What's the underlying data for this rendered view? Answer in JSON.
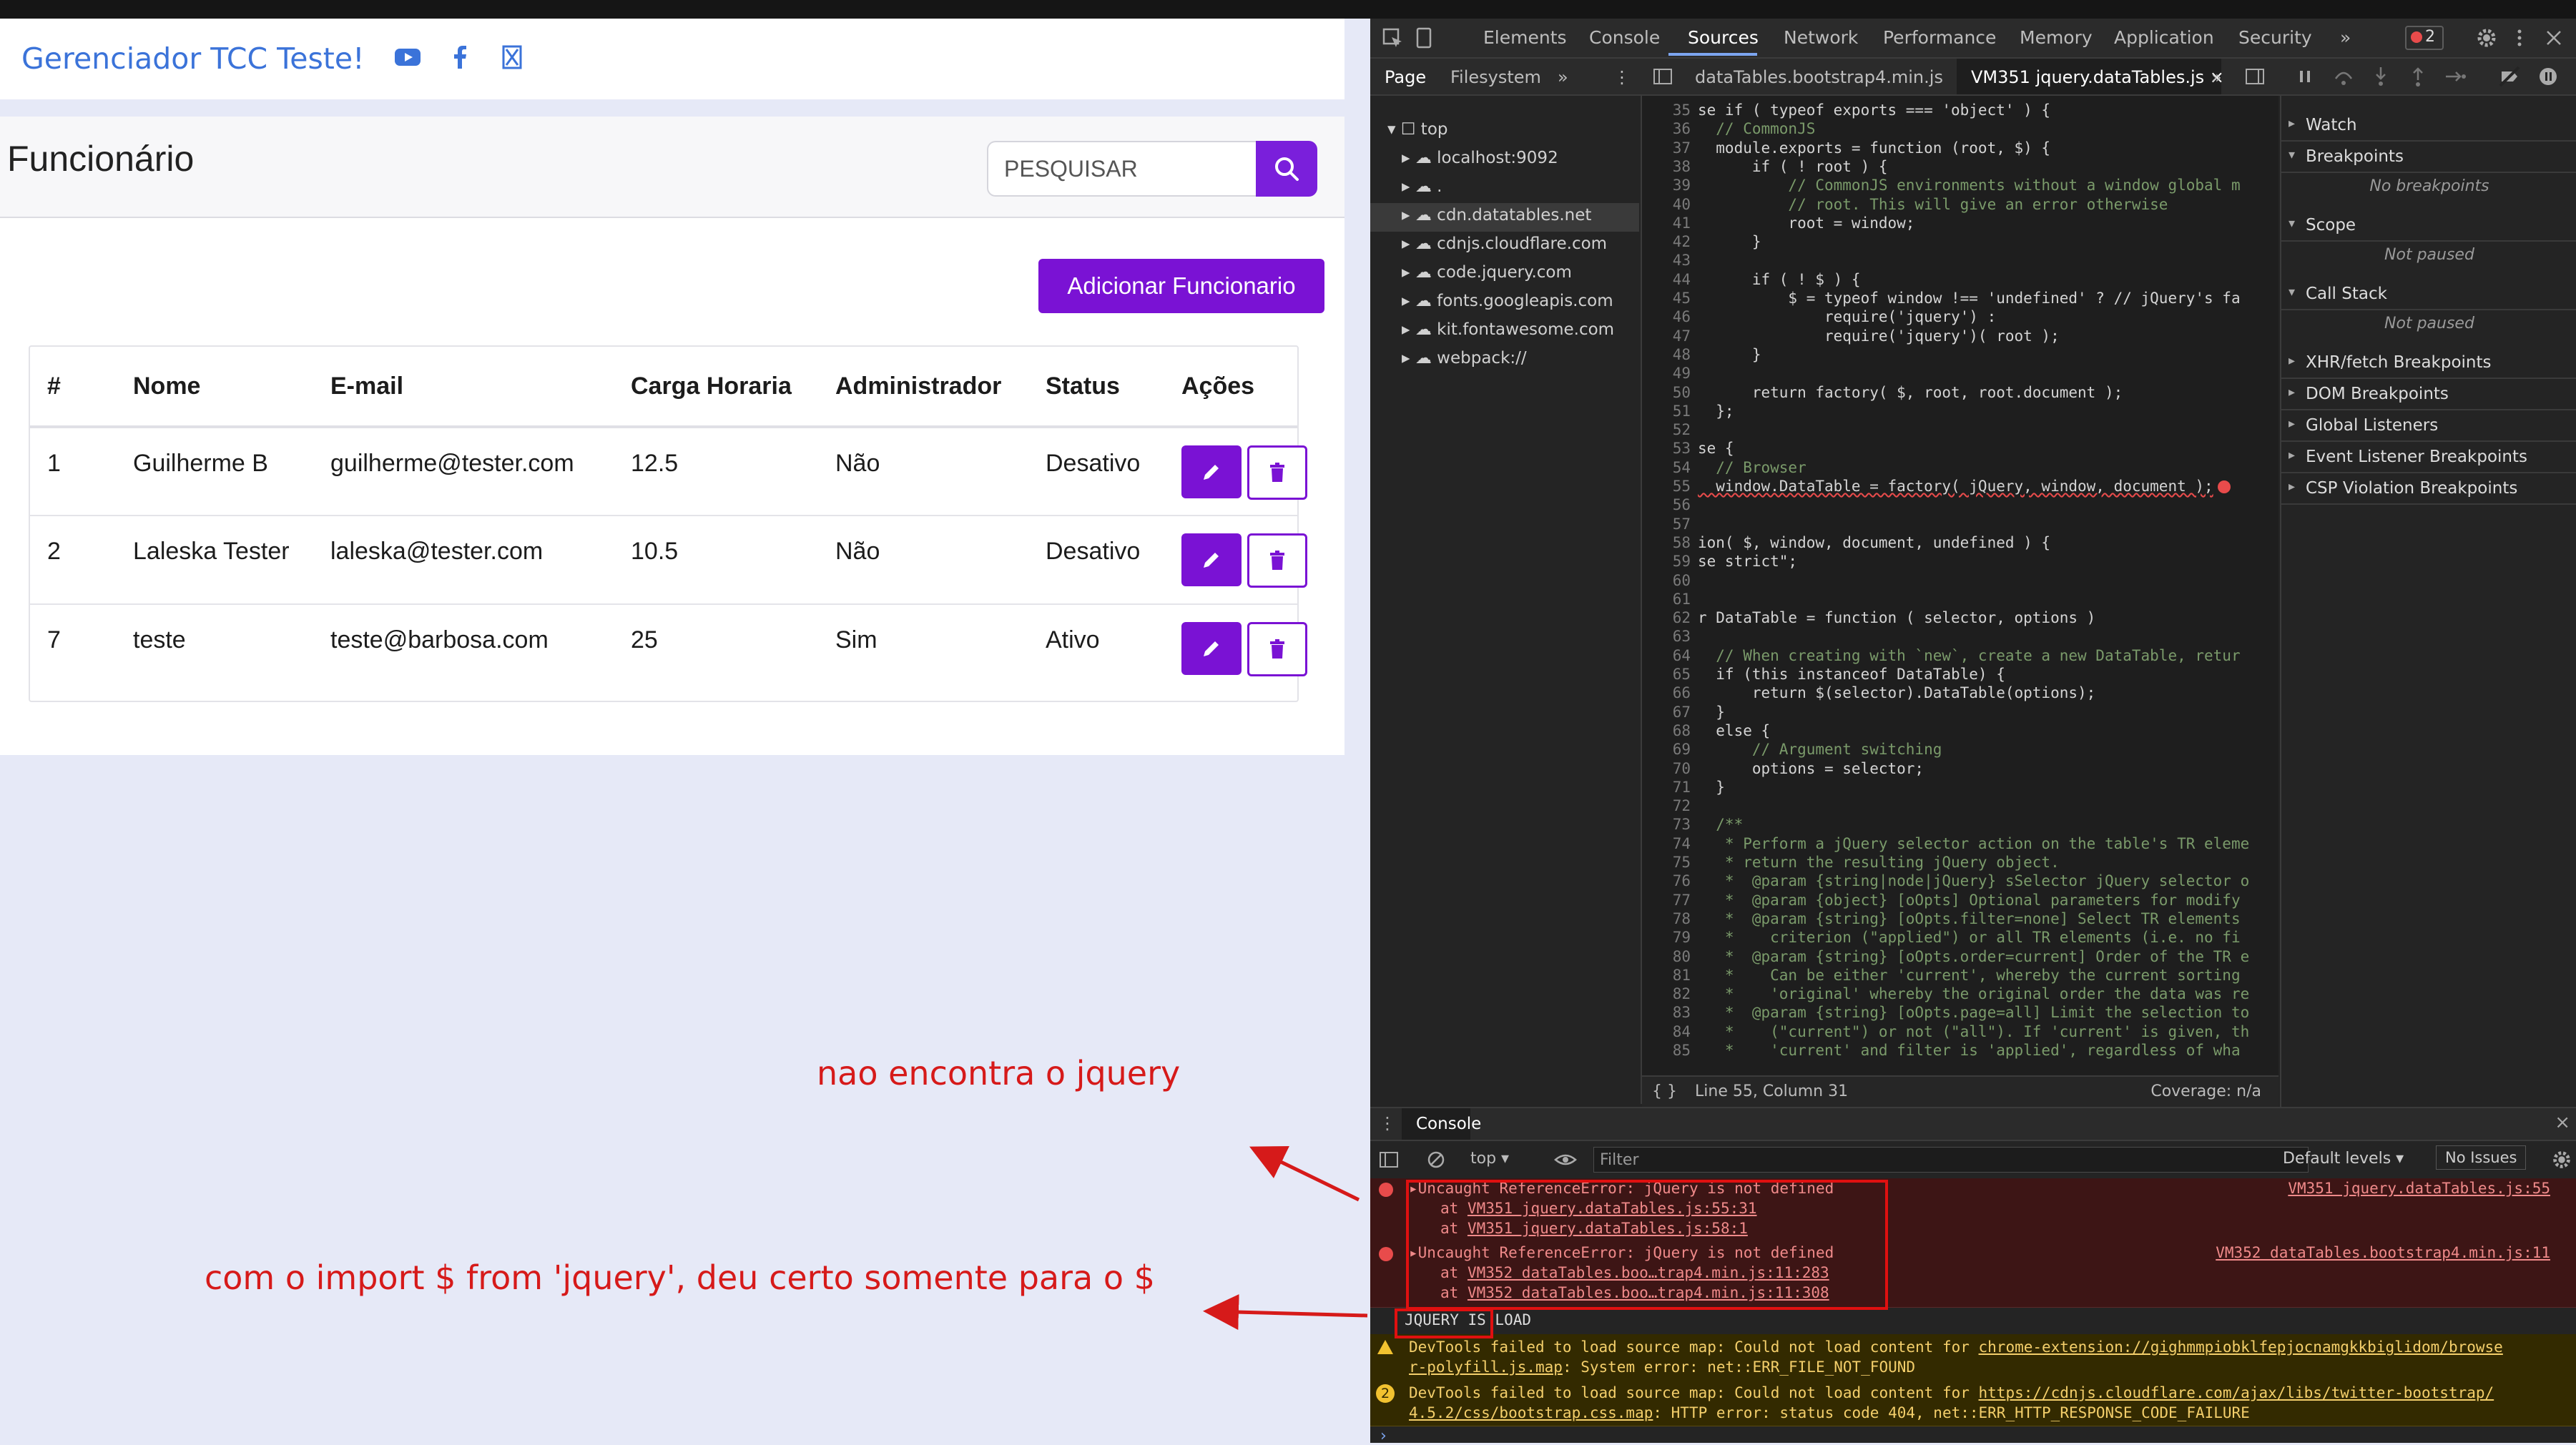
{
  "app": {
    "brand": "Gerenciador TCC Teste!",
    "social_icons": [
      "youtube-icon",
      "facebook-icon",
      "x-twitter-icon"
    ],
    "page_title": "Funcionário",
    "search": {
      "placeholder": "PESQUISAR"
    },
    "add_button": "Adicionar Funcionario",
    "table": {
      "headers": [
        "#",
        "Nome",
        "E-mail",
        "Carga Horaria",
        "Administrador",
        "Status",
        "Ações"
      ],
      "rows": [
        {
          "id": "1",
          "nome": "Guilherme B",
          "email": "guilherme@tester.com",
          "carga": "12.5",
          "admin": "Não",
          "status": "Desativo"
        },
        {
          "id": "2",
          "nome": "Laleska Tester",
          "email": "laleska@tester.com",
          "carga": "10.5",
          "admin": "Não",
          "status": "Desativo"
        },
        {
          "id": "7",
          "nome": "teste",
          "email": "teste@barbosa.com",
          "carga": "25",
          "admin": "Sim",
          "status": "Ativo"
        }
      ]
    },
    "accent_color": "#7a12d4",
    "brand_color": "#3b73d9"
  },
  "annotations": {
    "note1": "nao encontra o jquery",
    "note2": "com o import $ from 'jquery', deu certo somente para o $",
    "color": "#d61a1a"
  },
  "devtools": {
    "tabs": [
      "Elements",
      "Console",
      "Sources",
      "Network",
      "Performance",
      "Memory",
      "Application",
      "Security"
    ],
    "active_tab": "Sources",
    "error_count": "2",
    "sub_tabs": {
      "page": "Page",
      "filesystem": "Filesystem"
    },
    "file_tabs": [
      "dataTables.bootstrap4.min.js",
      "VM351 jquery.dataTables.js"
    ],
    "tree": [
      "top",
      "localhost:9092",
      ".",
      "cdn.datatables.net",
      "cdnjs.cloudflare.com",
      "code.jquery.com",
      "fonts.googleapis.com",
      "kit.fontawesome.com",
      "webpack://"
    ],
    "code_lines": [
      {
        "n": "35",
        "t": "se if ( typeof exports === 'object' ) {"
      },
      {
        "n": "36",
        "t": "  // CommonJS"
      },
      {
        "n": "37",
        "t": "  module.exports = function (root, $) {"
      },
      {
        "n": "38",
        "t": "      if ( ! root ) {"
      },
      {
        "n": "39",
        "t": "          // CommonJS environments without a window global m"
      },
      {
        "n": "40",
        "t": "          // root. This will give an error otherwise"
      },
      {
        "n": "41",
        "t": "          root = window;"
      },
      {
        "n": "42",
        "t": "      }"
      },
      {
        "n": "43",
        "t": ""
      },
      {
        "n": "44",
        "t": "      if ( ! $ ) {"
      },
      {
        "n": "45",
        "t": "          $ = typeof window !== 'undefined' ? // jQuery's fa"
      },
      {
        "n": "46",
        "t": "              require('jquery') :"
      },
      {
        "n": "47",
        "t": "              require('jquery')( root );"
      },
      {
        "n": "48",
        "t": "      }"
      },
      {
        "n": "49",
        "t": ""
      },
      {
        "n": "50",
        "t": "      return factory( $, root, root.document );"
      },
      {
        "n": "51",
        "t": "  };"
      },
      {
        "n": "52",
        "t": ""
      },
      {
        "n": "53",
        "t": "se {"
      },
      {
        "n": "54",
        "t": "  // Browser"
      },
      {
        "n": "55",
        "t": "  window.DataTable = factory( jQuery, window, document );"
      },
      {
        "n": "56",
        "t": ""
      },
      {
        "n": "57",
        "t": ""
      },
      {
        "n": "58",
        "t": "ion( $, window, document, undefined ) {"
      },
      {
        "n": "59",
        "t": "se strict\";"
      },
      {
        "n": "60",
        "t": ""
      },
      {
        "n": "61",
        "t": ""
      },
      {
        "n": "62",
        "t": "r DataTable = function ( selector, options )"
      },
      {
        "n": "63",
        "t": ""
      },
      {
        "n": "64",
        "t": "  // When creating with `new`, create a new DataTable, retur"
      },
      {
        "n": "65",
        "t": "  if (this instanceof DataTable) {"
      },
      {
        "n": "66",
        "t": "      return $(selector).DataTable(options);"
      },
      {
        "n": "67",
        "t": "  }"
      },
      {
        "n": "68",
        "t": "  else {"
      },
      {
        "n": "69",
        "t": "      // Argument switching"
      },
      {
        "n": "70",
        "t": "      options = selector;"
      },
      {
        "n": "71",
        "t": "  }"
      },
      {
        "n": "72",
        "t": ""
      },
      {
        "n": "73",
        "t": "  /**"
      },
      {
        "n": "74",
        "t": "   * Perform a jQuery selector action on the table's TR eleme"
      },
      {
        "n": "75",
        "t": "   * return the resulting jQuery object."
      },
      {
        "n": "76",
        "t": "   *  @param {string|node|jQuery} sSelector jQuery selector o"
      },
      {
        "n": "77",
        "t": "   *  @param {object} [oOpts] Optional parameters for modify"
      },
      {
        "n": "78",
        "t": "   *  @param {string} [oOpts.filter=none] Select TR elements"
      },
      {
        "n": "79",
        "t": "   *    criterion (\"applied\") or all TR elements (i.e. no fi"
      },
      {
        "n": "80",
        "t": "   *  @param {string} [oOpts.order=current] Order of the TR e"
      },
      {
        "n": "81",
        "t": "   *    Can be either 'current', whereby the current sorting"
      },
      {
        "n": "82",
        "t": "   *    'original' whereby the original order the data was re"
      },
      {
        "n": "83",
        "t": "   *  @param {string} [oOpts.page=all] Limit the selection to"
      },
      {
        "n": "84",
        "t": "   *    (\"current\") or not (\"all\"). If 'current' is given, th"
      },
      {
        "n": "85",
        "t": "   *    'current' and filter is 'applied', regardless of wha"
      }
    ],
    "status_bar": {
      "position": "Line 55, Column 31",
      "coverage": "Coverage: n/a"
    },
    "debug_sections": [
      {
        "label": "Watch",
        "note": ""
      },
      {
        "label": "Breakpoints",
        "note": "No breakpoints"
      },
      {
        "label": "Scope",
        "note": "Not paused"
      },
      {
        "label": "Call Stack",
        "note": "Not paused"
      },
      {
        "label": "XHR/fetch Breakpoints",
        "note": ""
      },
      {
        "label": "DOM Breakpoints",
        "note": ""
      },
      {
        "label": "Global Listeners",
        "note": ""
      },
      {
        "label": "Event Listener Breakpoints",
        "note": ""
      },
      {
        "label": "CSP Violation Breakpoints",
        "note": ""
      }
    ],
    "console": {
      "title": "Console",
      "context": "top",
      "filter_placeholder": "Filter",
      "levels": "Default levels",
      "issues": "No Issues",
      "errors": [
        {
          "msg": "Uncaught ReferenceError: jQuery is not defined",
          "at1": "VM351 jquery.dataTables.js:55:31",
          "at2": "VM351 jquery.dataTables.js:58:1",
          "src": "VM351 jquery.dataTables.js:55"
        },
        {
          "msg": "Uncaught ReferenceError: jQuery is not defined",
          "at1": "VM352 dataTables.boo…trap4.min.js:11:283",
          "at2": "VM352 dataTables.boo…trap4.min.js:11:308",
          "src": "VM352 dataTables.bootstrap4.min.js:11"
        }
      ],
      "log": "JQUERY IS LOAD",
      "warnings": [
        {
          "prefix": "DevTools failed to load source map: Could not load content for ",
          "link": "chrome-extension://gighmmpiobklfepjocnamgkkbiglidom/browse",
          "link2": "r-polyfill.js.map",
          "rest": ": System error: net::ERR_FILE_NOT_FOUND",
          "count": ""
        },
        {
          "prefix": "DevTools failed to load source map: Could not load content for ",
          "link": "https://cdnjs.cloudflare.com/ajax/libs/twitter-bootstrap/",
          "link2": "4.5.2/css/bootstrap.css.map",
          "rest": ": HTTP error: status code 404, net::ERR_HTTP_RESPONSE_CODE_FAILURE",
          "count": "2"
        }
      ]
    }
  }
}
